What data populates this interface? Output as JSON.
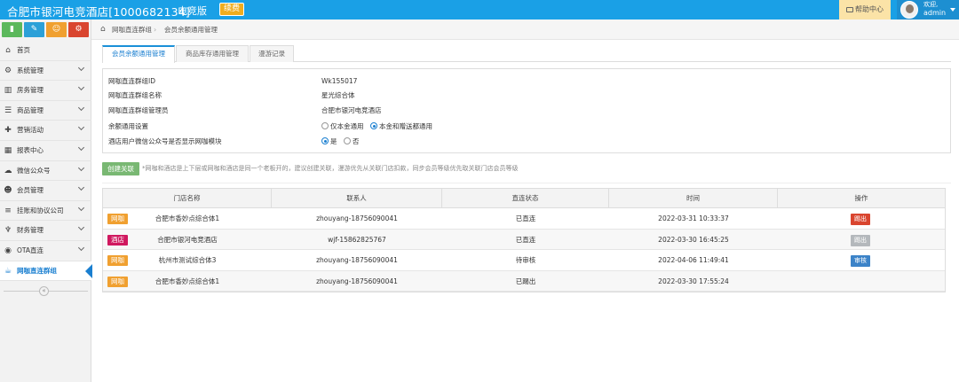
{
  "header": {
    "title": "合肥市银河电竞酒店[1000682134]",
    "edition": "电竞版",
    "renew_label": "续费",
    "help_label": "帮助中心",
    "welcome": "欢迎,",
    "username": "admin"
  },
  "colors": {
    "topbar": "#1aa0e6",
    "accent": "#1a7fd0",
    "badge_wangka": "#f0a030",
    "badge_hotel": "#d0185f",
    "btn_kick": "#d9452f",
    "btn_disabled": "#b4b8bc",
    "btn_audit": "#3c83c8",
    "btn_create": "#79b873"
  },
  "quick_buttons": [
    {
      "icon": "bar-chart-icon",
      "glyph": "▮",
      "color": "#5cb85c"
    },
    {
      "icon": "pencil-icon",
      "glyph": "✎",
      "color": "#2ca0d8"
    },
    {
      "icon": "users-icon",
      "glyph": "☺",
      "color": "#f0a030"
    },
    {
      "icon": "share-icon",
      "glyph": "⚙",
      "color": "#d9452f"
    }
  ],
  "sidebar": {
    "items": [
      {
        "label": "首页",
        "icon": "home-icon",
        "glyph": "⌂",
        "caret": false
      },
      {
        "label": "系统管理",
        "icon": "gear-icon",
        "glyph": "⚙",
        "caret": true
      },
      {
        "label": "房务管理",
        "icon": "building-icon",
        "glyph": "▥",
        "caret": true
      },
      {
        "label": "商品管理",
        "icon": "database-icon",
        "glyph": "☰",
        "caret": true
      },
      {
        "label": "营销活动",
        "icon": "gift-icon",
        "glyph": "✚",
        "caret": true
      },
      {
        "label": "报表中心",
        "icon": "chart-icon",
        "glyph": "▦",
        "caret": true
      },
      {
        "label": "微信公众号",
        "icon": "cloud-icon",
        "glyph": "☁",
        "caret": true
      },
      {
        "label": "会员管理",
        "icon": "users-icon",
        "glyph": "☻",
        "caret": true
      },
      {
        "label": "挂账和协议公司",
        "icon": "list-icon",
        "glyph": "≡",
        "caret": true
      },
      {
        "label": "财务管理",
        "icon": "cutlery-icon",
        "glyph": "♆",
        "caret": true
      },
      {
        "label": "OTA直连",
        "icon": "eye-icon",
        "glyph": "◉",
        "caret": true
      },
      {
        "label": "网咖直连群组",
        "icon": "coffee-icon",
        "glyph": "☕",
        "caret": false,
        "active": true
      }
    ],
    "collapse_glyph": "«"
  },
  "breadcrumb": {
    "home_glyph": "⌂",
    "level1": "网咖直连群组",
    "separator": "›",
    "level2": "会员余额通用管理"
  },
  "tabs": [
    {
      "label": "会员余额通用管理",
      "active": true
    },
    {
      "label": "商品库存通用管理",
      "active": false
    },
    {
      "label": "漫游记录",
      "active": false
    }
  ],
  "info": {
    "group_id_label": "网咖直连群组ID",
    "group_id": "Wk155017",
    "group_name_label": "网咖直连群组名称",
    "group_name": "星光综合体",
    "group_admin_label": "网咖直连群组管理员",
    "group_admin": "合肥市银河电竞酒店",
    "balance_label": "余额通用设置",
    "balance_option1": "仅本金通用",
    "balance_option2": "本金和赠送都通用",
    "balance_selected": 2,
    "wechat_label": "酒店用户微信公众号是否显示网咖模块",
    "wechat_yes": "是",
    "wechat_no": "否",
    "wechat_selected": "yes"
  },
  "create_button": "创建关联",
  "note": "*网咖和酒店是上下层或网咖和酒店是同一个老板开的，建议创建关联，漫游优先从关联门店扣款，同步会员等级优先取关联门店会员等级",
  "table": {
    "headers": [
      "门店名称",
      "联系人",
      "直连状态",
      "时间",
      "操作"
    ],
    "rows": [
      {
        "type": "网咖",
        "type_color": "#f0a030",
        "store": "合肥市香妙点综合体1",
        "contact": "zhouyang-18756090041",
        "status": "已直连",
        "time": "2022-03-31 10:33:37",
        "action": "踢出",
        "action_color": "#d9452f"
      },
      {
        "type": "酒店",
        "type_color": "#d0185f",
        "store": "合肥市银河电竞酒店",
        "contact": "wjf-15862825767",
        "status": "已直连",
        "time": "2022-03-30 16:45:25",
        "action": "踢出",
        "action_color": "#b4b8bc"
      },
      {
        "type": "网咖",
        "type_color": "#f0a030",
        "store": "杭州市测试综合体3",
        "contact": "zhouyang-18756090041",
        "status": "待审核",
        "time": "2022-04-06 11:49:41",
        "action": "审核",
        "action_color": "#3c83c8"
      },
      {
        "type": "网咖",
        "type_color": "#f0a030",
        "store": "合肥市香妙点综合体1",
        "contact": "zhouyang-18756090041",
        "status": "已踢出",
        "time": "2022-03-30 17:55:24",
        "action": "",
        "action_color": ""
      }
    ]
  }
}
